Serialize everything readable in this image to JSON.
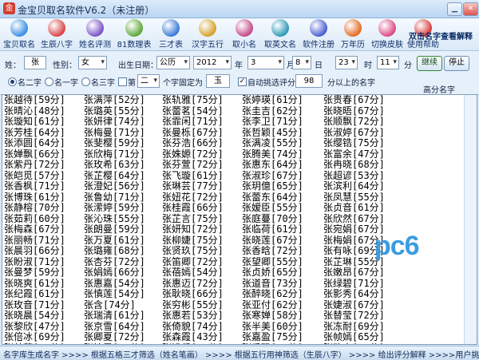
{
  "window": {
    "title": "金宝贝取名软件V6.2（未注册）",
    "app_icon": "金"
  },
  "toolbar": {
    "items": [
      {
        "label": "宝贝取名",
        "color": "#3a8ee6"
      },
      {
        "label": "生辰八字",
        "color": "#d9464a"
      },
      {
        "label": "姓名评测",
        "color": "#7a56c8"
      },
      {
        "label": "81数理表",
        "color": "#5fa83d"
      },
      {
        "label": "三才表",
        "color": "#3b7ad8"
      },
      {
        "label": "汉字五行",
        "color": "#d5a12b"
      },
      {
        "label": "取小名",
        "color": "#c44b8a"
      },
      {
        "label": "取英文名",
        "color": "#2f9bb7"
      },
      {
        "label": "软件注册",
        "color": "#4a5fd1"
      },
      {
        "label": "万年历",
        "color": "#e46c25"
      },
      {
        "label": "切换皮肤",
        "color": "#dc4b86"
      },
      {
        "label": "使用帮助",
        "color": "#d93c3c"
      }
    ],
    "hint": "双击名字查看解释"
  },
  "params": {
    "surname_label": "姓：",
    "surname": "张",
    "gender_label": "性别：",
    "gender": "女",
    "birth_label": "出生日期：",
    "calendar": "公历",
    "year": "2012",
    "year_unit": "年",
    "month": "3",
    "month_unit": "月",
    "day": "8",
    "day_unit": "日",
    "hour": "23",
    "hour_unit": "时",
    "minute": "11",
    "minute_unit": "分",
    "continue_button": "继续",
    "stop_button": "停止",
    "opt_two_char": "名二字",
    "opt_one_char": "名一字",
    "opt_three_char": "名三字",
    "nth_label": "第",
    "nth_value": "二",
    "fixed_label": "个字固定为",
    "fixed_value": "玉",
    "auto_label": "自动挑选评分为",
    "score_value": "98",
    "score_suffix": "分以上的名字",
    "high_score_label": "高分名字"
  },
  "names": {
    "col1": [
      "张越待[59分]",
      "张晴沁[48分]",
      "张璇知[61分]",
      "张芳桂[64分]",
      "张添圆[64分]",
      "张婵飘[66分]",
      "张紫丹[72分]",
      "张皑觅[57分]",
      "张香枫[71分]",
      "张博珠[61分]",
      "张静榕[70分]",
      "张茹莉[60分]",
      "张梅森[67分]",
      "张丽畅[71分]",
      "张晨羽[66分]",
      "张盼淑[71分]",
      "张曼梦[59分]",
      "张晓爽[61分]",
      "张纪霞[61分]",
      "张玫音[71分]",
      "张晓晨[54分]",
      "张黎欣[47分]",
      "张倍冰[69分]",
      "张楚萍[66分]",
      "张凌缘[59分]"
    ],
    "col2": [
      "张满萍[52分]",
      "张璐英[55分]",
      "张妍律[74分]",
      "张梅曼[71分]",
      "张斐樱[59分]",
      "张欣梅[71分]",
      "张玫希[63分]",
      "张芷樱[64分]",
      "张澄妃[56分]",
      "张鲁幼[71分]",
      "张潆婷[59分]",
      "张沁珠[55分]",
      "张朗曼[59分]",
      "张万夏[61分]",
      "张璐雍[68分]",
      "张杏芬[72分]",
      "张娟嫣[66分]",
      "张惠嘉[54分]",
      "张慎莲[54分]",
      "张含[74分]",
      "张瑞清[61分]",
      "张京雪[64分]",
      "张卿夏[72分]",
      "张铭霞[71分]",
      "张依萍[67分]"
    ],
    "col3": [
      "张轨雅[75分]",
      "张蕾茗[54分]",
      "张霏闲[71分]",
      "张曼栎[67分]",
      "张芬浩[66分]",
      "张姝嫄[72分]",
      "张芬萱[72分]",
      "张飞璇[61分]",
      "张琳芸[77分]",
      "张妞花[72分]",
      "张桂霞[66分]",
      "张芷言[75分]",
      "张妍知[72分]",
      "张柳婕[75分]",
      "张贤玖[75分]",
      "张笛卿[72分]",
      "张蓓嫣[54分]",
      "张惠迈[72分]",
      "张耿晓[66分]",
      "张穷彬[55分]",
      "张惠若[53分]",
      "张倚貌[74分]",
      "张森霞[43分]",
      "张沿侨[51分]",
      "张瑛静[55分]"
    ],
    "col4": [
      "张婷瑛[61分]",
      "张圭吉[62分]",
      "张李卫[71分]",
      "张哲颖[45分]",
      "张满凌[55分]",
      "张腾美[74分]",
      "张惠东[64分]",
      "张淑珍[67分]",
      "张玥億[65分]",
      "张蕾东[64分]",
      "张嫒臣[55分]",
      "张庭蔓[70分]",
      "张临荷[61分]",
      "张晓莲[67分]",
      "张香晗[72分]",
      "张望卿[55分]",
      "张贞娇[65分]",
      "张道音[73分]",
      "张醉晓[62分]",
      "张亚付[62分]",
      "张寒婵[58分]",
      "张半美[60分]",
      "张嘉盈[75分]",
      "张乔码[59分]",
      "张嗒婧[61分]"
    ],
    "col5": [
      "张贵春[67分]",
      "张晓晤[67分]",
      "张顺飘[72分]",
      "张淑婷[67分]",
      "张缨锆[75分]",
      "张富余[47分]",
      "张冉晓[68分]",
      "张超谚[53分]",
      "张滨利[64分]",
      "张凤慧[55分]",
      "张贞音[61分]",
      "张欣然[67分]",
      "张宛娟[67分]",
      "张梅娟[67分]",
      "张有咏[69分]",
      "张芷琳[55分]",
      "张嫩昂[67分]",
      "张绿碧[71分]",
      "张影秀[64分]",
      "张婕淑[67分]",
      "张替莹[72分]",
      "张冻耐[69分]",
      "张帧嫣[65分]",
      "张改音[75分]",
      "张微微[75分]"
    ]
  },
  "status": {
    "text": "名字库生成名字 >>>> 根据五格三才筛选（姓名笔画） >>>> 根据五行用神筛选（生辰八字） >>>> 给出评分解释 >>>>用户挑选"
  }
}
